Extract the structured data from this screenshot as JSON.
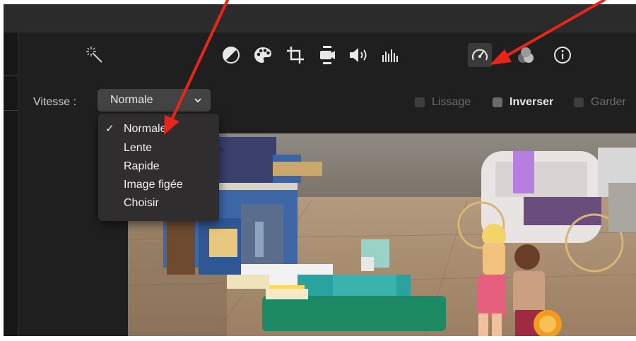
{
  "toolbar": {
    "icons": [
      {
        "name": "magic-wand-icon"
      },
      {
        "name": "color-balance-icon"
      },
      {
        "name": "color-palette-icon"
      },
      {
        "name": "crop-icon"
      },
      {
        "name": "stabilization-icon"
      },
      {
        "name": "volume-icon"
      },
      {
        "name": "equalizer-icon"
      },
      {
        "name": "speed-icon",
        "active": true
      },
      {
        "name": "filters-icon"
      },
      {
        "name": "info-icon"
      }
    ]
  },
  "speed": {
    "label": "Vitesse :",
    "selected": "Normale",
    "options": [
      "Normale",
      "Lente",
      "Rapide",
      "Image figée",
      "Choisir"
    ]
  },
  "options": [
    {
      "label": "Lissage",
      "checked": false
    },
    {
      "label": "Inverser",
      "checked": true
    },
    {
      "label": "Garder",
      "checked": false
    }
  ],
  "colors": {
    "background": "#1f1f1f",
    "menu": "#2f2d2d",
    "annotation_arrow": "#e8251a"
  }
}
